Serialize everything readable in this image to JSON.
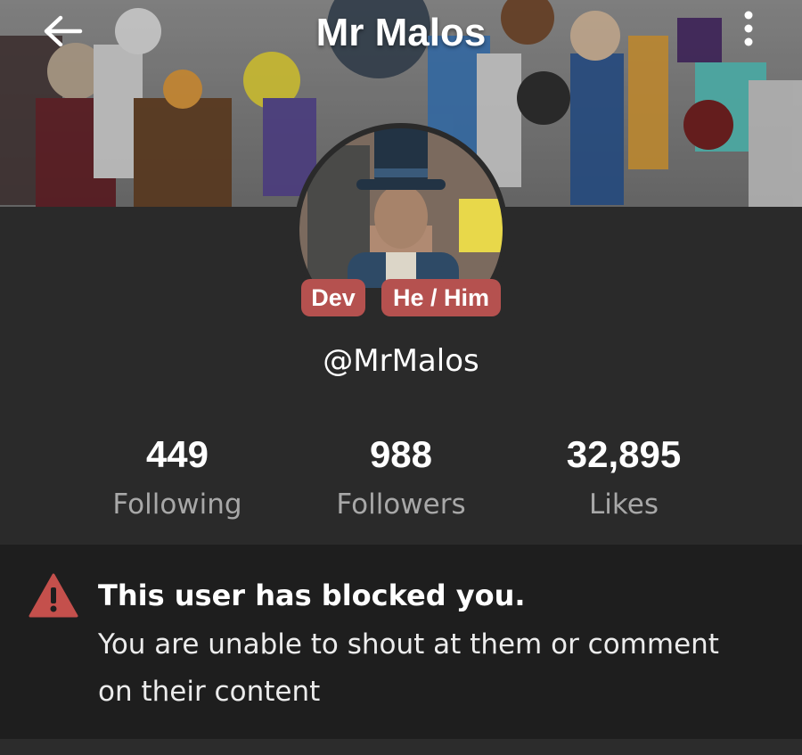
{
  "header": {
    "title": "Mr Malos",
    "back_icon": "arrow-left-icon",
    "menu_icon": "more-vertical-icon"
  },
  "profile": {
    "badges": [
      "Dev",
      "He / Him"
    ],
    "handle": "@MrMalos"
  },
  "stats": [
    {
      "value": "449",
      "label": "Following"
    },
    {
      "value": "988",
      "label": "Followers"
    },
    {
      "value": "32,895",
      "label": "Likes"
    }
  ],
  "notice": {
    "icon": "warning-triangle-icon",
    "title": "This user has blocked you.",
    "body": "You are unable to shout at them or comment on their content"
  },
  "colors": {
    "background": "#2a2a2a",
    "notice_background": "#1e1e1e",
    "badge": "#b5514f",
    "muted_text": "#a8a8a8",
    "warning": "#c4504c"
  }
}
